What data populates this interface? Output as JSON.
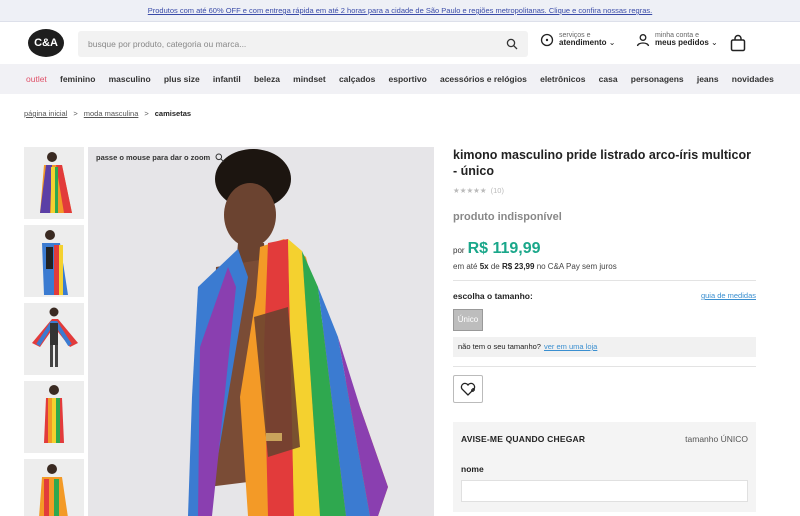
{
  "promo": {
    "text": "Produtos com até 60% OFF e com entrega rápida em até 2 horas para a cidade de São Paulo e regiões metropolitanas. Clique e confira nossas regras."
  },
  "header": {
    "logo": "C&A",
    "search_placeholder": "busque por produto, categoria ou marca...",
    "service_small": "serviços e",
    "service_big": "atendimento",
    "account_small": "minha conta e",
    "account_big": "meus pedidos"
  },
  "nav": {
    "items": [
      "outlet",
      "feminino",
      "masculino",
      "plus size",
      "infantil",
      "beleza",
      "mindset",
      "calçados",
      "esportivo",
      "acessórios e relógios",
      "eletrônicos",
      "casa",
      "personagens",
      "jeans",
      "novidades"
    ]
  },
  "breadcrumb": {
    "home": "página inicial",
    "category": "moda masculina",
    "current": "camisetas",
    "separator": ">"
  },
  "gallery": {
    "zoom_hint": "passe o mouse para dar o zoom"
  },
  "product": {
    "title": "kimono masculino pride listrado arco-íris multicor - único",
    "stars": "★★★★★",
    "reviews": "(10)",
    "unavailable": "produto indisponível",
    "price_prefix": "por",
    "price": "R$ 119,99",
    "installments_pre": "em até",
    "installments_n": "5x",
    "installments_de": "de",
    "installments_value": "R$ 23,99",
    "installments_post": "no C&A Pay sem juros",
    "size_label": "escolha o tamanho:",
    "size_guide": "guia de medidas",
    "size_option": "Único",
    "nosize_text": "não tem o seu tamanho?",
    "nosize_link": "ver em uma loja",
    "notify_title": "AVISE-ME QUANDO CHEGAR",
    "notify_size": "tamanho ÚNICO",
    "notify_name_label": "nome"
  },
  "colors": {
    "accent_green": "#1aa78a",
    "outlet_pink": "#e0526a",
    "link_blue": "#3a8fd0"
  }
}
